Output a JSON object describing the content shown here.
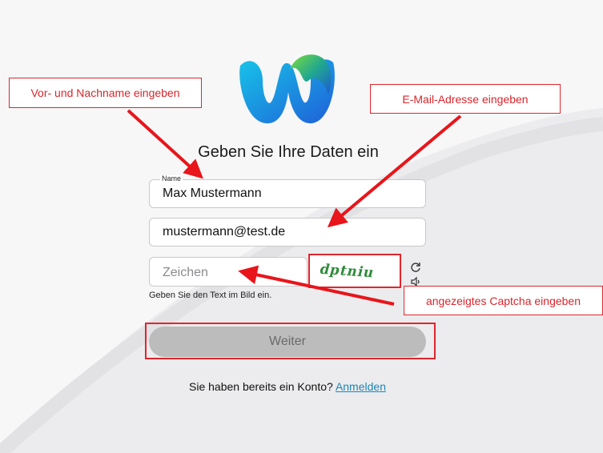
{
  "form": {
    "heading": "Geben Sie Ihre Daten ein",
    "name_label": "Name",
    "name_value": "Max Mustermann",
    "email_value": "mustermann@test.de",
    "captcha_placeholder": "Zeichen",
    "captcha_image_text": "dptniu",
    "captcha_hint": "Geben Sie den Text im Bild ein.",
    "submit_label": "Weiter",
    "signin_prompt": "Sie haben bereits ein Konto?",
    "signin_link": "Anmelden"
  },
  "annotations": {
    "name_callout": "Vor- und Nachname eingeben",
    "email_callout": "E-Mail-Adresse eingeben",
    "captcha_callout": "angezeigtes Captcha eingeben"
  },
  "icons": {
    "refresh": "refresh-icon",
    "audio": "speaker-icon",
    "logo": "webex-logo"
  },
  "colors": {
    "annotation_red": "#e0262c",
    "link_blue": "#1b86b8",
    "button_disabled": "#bcbcbc",
    "captcha_green": "#2e8b3a"
  }
}
